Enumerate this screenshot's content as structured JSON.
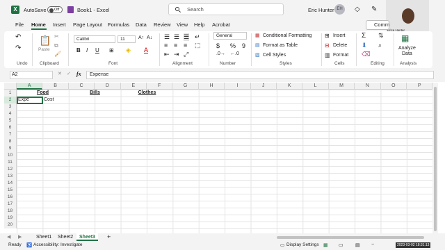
{
  "titlebar": {
    "logo": "X",
    "autosave_label": "AutoSave",
    "autosave_state": "Off",
    "book_title": "Book1",
    "app_name": "Excel",
    "search_placeholder": "Search",
    "user_name": "Eric Hunter",
    "user_initials": "EH"
  },
  "webcam": {
    "label": "Erica Hunter"
  },
  "menu": {
    "items": [
      "File",
      "Home",
      "Insert",
      "Page Layout",
      "Formulas",
      "Data",
      "Review",
      "View",
      "Help",
      "Acrobat"
    ],
    "active": "Home",
    "comments_label": "Comm"
  },
  "ribbon": {
    "undo": {
      "label": "Undo"
    },
    "clipboard": {
      "label": "Clipboard",
      "paste": "Paste"
    },
    "font": {
      "label": "Font",
      "name": "Calibri",
      "size": "11",
      "bold": "B",
      "italic": "I",
      "underline": "U"
    },
    "alignment": {
      "label": "Alignment"
    },
    "number": {
      "label": "Number",
      "format": "General",
      "currency": "$",
      "percent": "%",
      "comma": "9"
    },
    "styles": {
      "label": "Styles",
      "conditional": "Conditional Formatting",
      "table": "Format as Table",
      "cell": "Cell Styles"
    },
    "cells": {
      "label": "Cells",
      "insert": "Insert",
      "delete": "Delete",
      "format": "Format"
    },
    "editing": {
      "label": "Editing"
    },
    "analysis": {
      "label": "Analysis",
      "analyze": "Analyze",
      "data": "Data"
    }
  },
  "formula_bar": {
    "name_box": "A2",
    "fx": "fx",
    "content": "Expense"
  },
  "grid": {
    "columns": [
      "A",
      "B",
      "C",
      "D",
      "E",
      "F",
      "G",
      "H",
      "I",
      "J",
      "K",
      "L",
      "M",
      "N",
      "O",
      "P"
    ],
    "rows": [
      "1",
      "2",
      "3",
      "4",
      "5",
      "6",
      "7",
      "8",
      "9",
      "10",
      "11",
      "12",
      "13",
      "14",
      "15",
      "16",
      "17",
      "18",
      "19",
      "20"
    ],
    "selected_cell": "A2",
    "cells": {
      "A1_B1": "Food",
      "C1_D1": "Bills",
      "E1_F1": "Clothes",
      "A2": "Expe",
      "B2": "Cost"
    }
  },
  "sheets": {
    "tabs": [
      "Sheet1",
      "Sheet2",
      "Sheet3"
    ],
    "active": "Sheet3",
    "add": "+"
  },
  "status": {
    "ready": "Ready",
    "accessibility": "Accessibility: Investigate",
    "display_settings": "Display Settings",
    "timestamp": "2023-03-02 18:31:13"
  },
  "colors": {
    "accent": "#1f7244",
    "ribbon_bg": "#ffffff",
    "app_bg": "#f3f3f3"
  }
}
